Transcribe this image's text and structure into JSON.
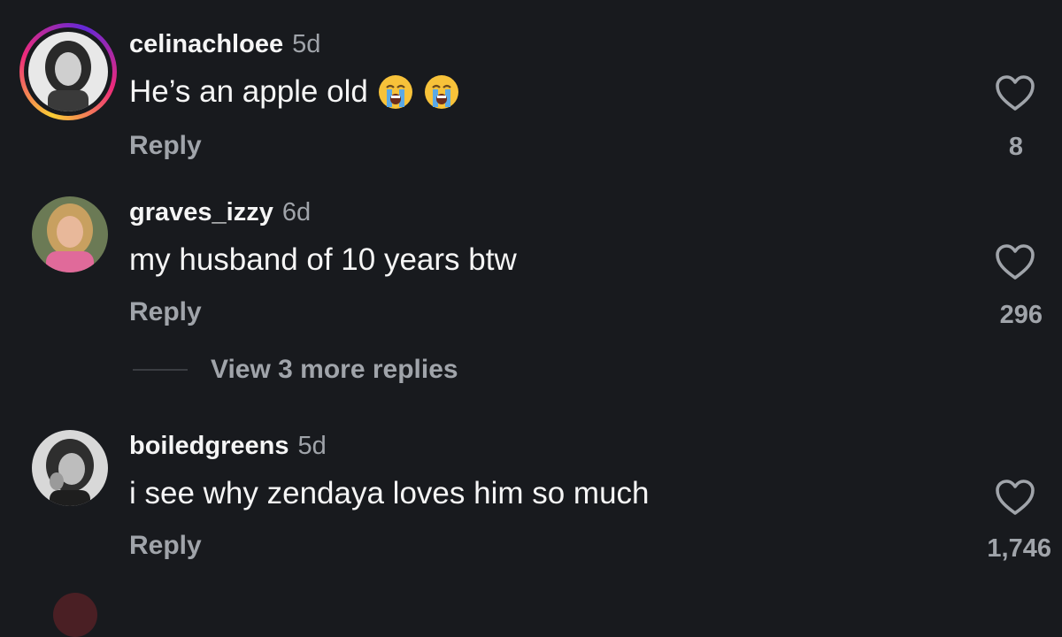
{
  "comments": [
    {
      "username": "celinachloee",
      "time": "5d",
      "text": "He’s an apple old",
      "emojis": [
        "loudly-crying-face",
        "loudly-crying-face"
      ],
      "reply_label": "Reply",
      "likes": "8",
      "has_story_ring": true
    },
    {
      "username": "graves_izzy",
      "time": "6d",
      "text": "my husband of 10 years btw",
      "reply_label": "Reply",
      "likes": "296",
      "view_more": "View 3 more replies"
    },
    {
      "username": "boiledgreens",
      "time": "5d",
      "text": "i see why zendaya loves him so much",
      "reply_label": "Reply",
      "likes": "1,746"
    }
  ],
  "colors": {
    "background": "#181a1e",
    "primary_text": "#f5f5f5",
    "secondary_text": "#a0a4aa"
  }
}
